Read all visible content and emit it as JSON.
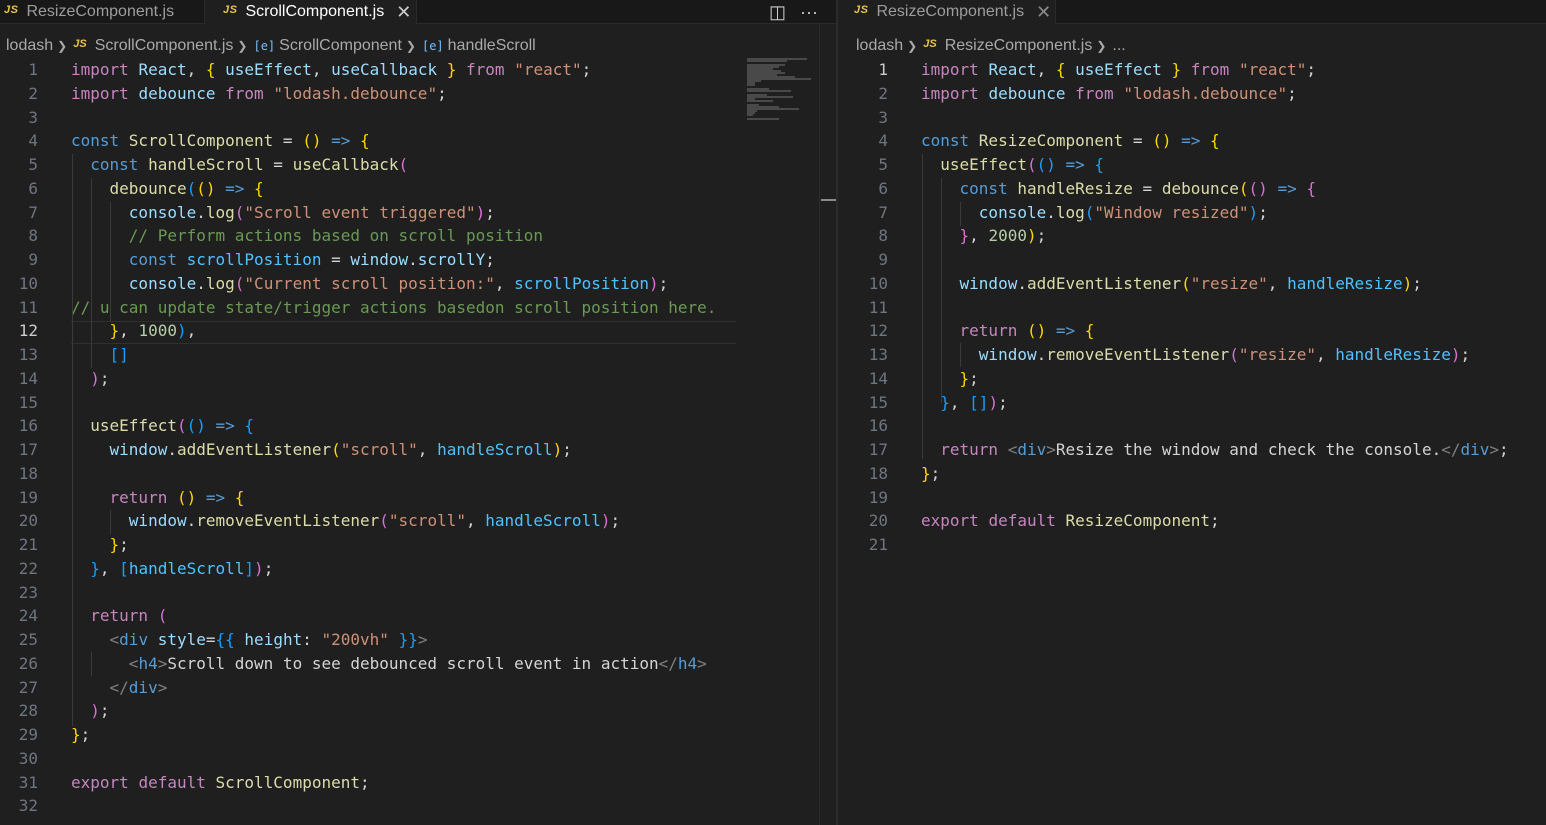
{
  "colors": {
    "keyword": "#569cd6",
    "control": "#c586c0",
    "function": "#dcdcaa",
    "variable": "#9cdcfe",
    "constant": "#4fc1ff",
    "string": "#ce9178",
    "number": "#b5cea8",
    "comment": "#6a9955",
    "punctuation": "#d4d4d4",
    "bracket1": "#ffd700",
    "bracket2": "#da70d6",
    "bracket3": "#179fff",
    "tag": "#808080"
  },
  "left": {
    "tabs": [
      {
        "icon": "js-file-icon",
        "icon_text": "JS",
        "label": "ResizeComponent.js",
        "active": false
      },
      {
        "icon": "js-file-icon",
        "icon_text": "JS",
        "label": "ScrollComponent.js",
        "active": true,
        "close": "✕"
      }
    ],
    "actions": [
      {
        "name": "split-editor-icon",
        "glyph": "◫"
      },
      {
        "name": "more-actions-icon",
        "glyph": "···"
      }
    ],
    "breadcrumb": {
      "folder": "lodash",
      "js_icon": "JS",
      "file": "ScrollComponent.js",
      "symbol_icon": "[e]",
      "symbol": "ScrollComponent",
      "member_icon": "[e]",
      "member": "handleScroll"
    },
    "current_line": 12,
    "lines": [
      [
        [
          "import ",
          "c"
        ],
        [
          "React",
          "v"
        ],
        [
          ", ",
          "p"
        ],
        [
          "{",
          "b1"
        ],
        [
          " ",
          "p"
        ],
        [
          "useEffect",
          "v"
        ],
        [
          ", ",
          "p"
        ],
        [
          "useCallback",
          "v"
        ],
        [
          " ",
          "p"
        ],
        [
          "}",
          "b1"
        ],
        [
          " ",
          "p"
        ],
        [
          "from",
          "c"
        ],
        [
          " ",
          "p"
        ],
        [
          "\"react\"",
          "s"
        ],
        [
          ";",
          "p"
        ]
      ],
      [
        [
          "import ",
          "c"
        ],
        [
          "debounce",
          "v"
        ],
        [
          " ",
          "p"
        ],
        [
          "from",
          "c"
        ],
        [
          " ",
          "p"
        ],
        [
          "\"lodash.debounce\"",
          "s"
        ],
        [
          ";",
          "p"
        ]
      ],
      [],
      [
        [
          "const ",
          "k"
        ],
        [
          "ScrollComponent",
          "f"
        ],
        [
          " = ",
          "p"
        ],
        [
          "()",
          "b1"
        ],
        [
          " ",
          "p"
        ],
        [
          "=>",
          "k"
        ],
        [
          " ",
          "p"
        ],
        [
          "{",
          "b1"
        ]
      ],
      [
        [
          "  const ",
          "k"
        ],
        [
          "handleScroll",
          "f"
        ],
        [
          " = ",
          "p"
        ],
        [
          "useCallback",
          "f"
        ],
        [
          "(",
          "b2"
        ]
      ],
      [
        [
          "    debounce",
          "f"
        ],
        [
          "(",
          "b3"
        ],
        [
          "()",
          "b1"
        ],
        [
          " ",
          "p"
        ],
        [
          "=>",
          "k"
        ],
        [
          " ",
          "p"
        ],
        [
          "{",
          "b1"
        ]
      ],
      [
        [
          "      console",
          "v"
        ],
        [
          ".",
          "p"
        ],
        [
          "log",
          "f"
        ],
        [
          "(",
          "b2"
        ],
        [
          "\"Scroll event triggered\"",
          "s"
        ],
        [
          ")",
          "b2"
        ],
        [
          ";",
          "p"
        ]
      ],
      [
        [
          "      // Perform actions based on scroll position",
          "cm"
        ]
      ],
      [
        [
          "      const ",
          "k"
        ],
        [
          "scrollPosition",
          "t"
        ],
        [
          " = ",
          "p"
        ],
        [
          "window",
          "v"
        ],
        [
          ".",
          "p"
        ],
        [
          "scrollY",
          "v"
        ],
        [
          ";",
          "p"
        ]
      ],
      [
        [
          "      console",
          "v"
        ],
        [
          ".",
          "p"
        ],
        [
          "log",
          "f"
        ],
        [
          "(",
          "b2"
        ],
        [
          "\"Current scroll position:\"",
          "s"
        ],
        [
          ", ",
          "p"
        ],
        [
          "scrollPosition",
          "t"
        ],
        [
          ")",
          "b2"
        ],
        [
          ";",
          "p"
        ]
      ],
      [
        [
          "// u can update state/trigger actions basedon scroll position here.",
          "cm"
        ]
      ],
      [
        [
          "    }",
          "b1"
        ],
        [
          ", ",
          "p"
        ],
        [
          "1000",
          "n"
        ],
        [
          ")",
          "b3"
        ],
        [
          ",",
          "p"
        ]
      ],
      [
        [
          "    []",
          "b3"
        ]
      ],
      [
        [
          "  )",
          "b2"
        ],
        [
          ";",
          "p"
        ]
      ],
      [],
      [
        [
          "  useEffect",
          "f"
        ],
        [
          "(",
          "b2"
        ],
        [
          "()",
          "b3"
        ],
        [
          " ",
          "p"
        ],
        [
          "=>",
          "k"
        ],
        [
          " ",
          "p"
        ],
        [
          "{",
          "b3"
        ]
      ],
      [
        [
          "    window",
          "v"
        ],
        [
          ".",
          "p"
        ],
        [
          "addEventListener",
          "f"
        ],
        [
          "(",
          "b1"
        ],
        [
          "\"scroll\"",
          "s"
        ],
        [
          ", ",
          "p"
        ],
        [
          "handleScroll",
          "t"
        ],
        [
          ")",
          "b1"
        ],
        [
          ";",
          "p"
        ]
      ],
      [],
      [
        [
          "    return ",
          "c"
        ],
        [
          "()",
          "b1"
        ],
        [
          " ",
          "p"
        ],
        [
          "=>",
          "k"
        ],
        [
          " ",
          "p"
        ],
        [
          "{",
          "b1"
        ]
      ],
      [
        [
          "      window",
          "v"
        ],
        [
          ".",
          "p"
        ],
        [
          "removeEventListener",
          "f"
        ],
        [
          "(",
          "b2"
        ],
        [
          "\"scroll\"",
          "s"
        ],
        [
          ", ",
          "p"
        ],
        [
          "handleScroll",
          "t"
        ],
        [
          ")",
          "b2"
        ],
        [
          ";",
          "p"
        ]
      ],
      [
        [
          "    }",
          "b1"
        ],
        [
          ";",
          "p"
        ]
      ],
      [
        [
          "  }",
          "b3"
        ],
        [
          ", ",
          "p"
        ],
        [
          "[",
          "b3"
        ],
        [
          "handleScroll",
          "t"
        ],
        [
          "]",
          "b3"
        ],
        [
          ")",
          "b2"
        ],
        [
          ";",
          "p"
        ]
      ],
      [],
      [
        [
          "  return ",
          "c"
        ],
        [
          "(",
          "b2"
        ]
      ],
      [
        [
          "    <",
          "g"
        ],
        [
          "div ",
          "k"
        ],
        [
          "style",
          "v"
        ],
        [
          "=",
          "p"
        ],
        [
          "{{",
          "b3"
        ],
        [
          " ",
          "p"
        ],
        [
          "height",
          "v"
        ],
        [
          ": ",
          "p"
        ],
        [
          "\"200vh\"",
          "s"
        ],
        [
          " ",
          "p"
        ],
        [
          "}}",
          "b3"
        ],
        [
          ">",
          "g"
        ]
      ],
      [
        [
          "      <",
          "g"
        ],
        [
          "h4",
          "k"
        ],
        [
          ">",
          "g"
        ],
        [
          "Scroll down to see debounced scroll event in action",
          "p"
        ],
        [
          "</",
          "g"
        ],
        [
          "h4",
          "k"
        ],
        [
          ">",
          "g"
        ]
      ],
      [
        [
          "    </",
          "g"
        ],
        [
          "div",
          "k"
        ],
        [
          ">",
          "g"
        ]
      ],
      [
        [
          "  )",
          "b2"
        ],
        [
          ";",
          "p"
        ]
      ],
      [
        [
          "}",
          "b1"
        ],
        [
          ";",
          "p"
        ]
      ],
      [],
      [
        [
          "export ",
          "c"
        ],
        [
          "default ",
          "c"
        ],
        [
          "ScrollComponent",
          "f"
        ],
        [
          ";",
          "p"
        ]
      ],
      []
    ]
  },
  "right": {
    "tabs": [
      {
        "icon": "js-file-icon",
        "icon_text": "JS",
        "label": "ResizeComponent.js",
        "active": true,
        "close": "✕"
      }
    ],
    "breadcrumb": {
      "folder": "lodash",
      "js_icon": "JS",
      "file": "ResizeComponent.js",
      "ellipsis": "..."
    },
    "current_line": 1,
    "lines": [
      [
        [
          "import ",
          "c"
        ],
        [
          "React",
          "v"
        ],
        [
          ", ",
          "p"
        ],
        [
          "{",
          "b1"
        ],
        [
          " ",
          "p"
        ],
        [
          "useEffect",
          "v"
        ],
        [
          " ",
          "p"
        ],
        [
          "}",
          "b1"
        ],
        [
          " ",
          "p"
        ],
        [
          "from",
          "c"
        ],
        [
          " ",
          "p"
        ],
        [
          "\"react\"",
          "s"
        ],
        [
          ";",
          "p"
        ]
      ],
      [
        [
          "import ",
          "c"
        ],
        [
          "debounce",
          "v"
        ],
        [
          " ",
          "p"
        ],
        [
          "from",
          "c"
        ],
        [
          " ",
          "p"
        ],
        [
          "\"lodash.debounce\"",
          "s"
        ],
        [
          ";",
          "p"
        ]
      ],
      [],
      [
        [
          "const ",
          "k"
        ],
        [
          "ResizeComponent",
          "f"
        ],
        [
          " = ",
          "p"
        ],
        [
          "()",
          "b1"
        ],
        [
          " ",
          "p"
        ],
        [
          "=>",
          "k"
        ],
        [
          " ",
          "p"
        ],
        [
          "{",
          "b1"
        ]
      ],
      [
        [
          "  useEffect",
          "f"
        ],
        [
          "(",
          "b2"
        ],
        [
          "()",
          "b3"
        ],
        [
          " ",
          "p"
        ],
        [
          "=>",
          "k"
        ],
        [
          " ",
          "p"
        ],
        [
          "{",
          "b3"
        ]
      ],
      [
        [
          "    const ",
          "k"
        ],
        [
          "handleResize",
          "f"
        ],
        [
          " = ",
          "p"
        ],
        [
          "debounce",
          "f"
        ],
        [
          "(",
          "b1"
        ],
        [
          "()",
          "b2"
        ],
        [
          " ",
          "p"
        ],
        [
          "=>",
          "k"
        ],
        [
          " ",
          "p"
        ],
        [
          "{",
          "b2"
        ]
      ],
      [
        [
          "      console",
          "v"
        ],
        [
          ".",
          "p"
        ],
        [
          "log",
          "f"
        ],
        [
          "(",
          "b3"
        ],
        [
          "\"Window resized\"",
          "s"
        ],
        [
          ")",
          "b3"
        ],
        [
          ";",
          "p"
        ]
      ],
      [
        [
          "    }",
          "b2"
        ],
        [
          ", ",
          "p"
        ],
        [
          "2000",
          "n"
        ],
        [
          ")",
          "b1"
        ],
        [
          ";",
          "p"
        ]
      ],
      [],
      [
        [
          "    window",
          "v"
        ],
        [
          ".",
          "p"
        ],
        [
          "addEventListener",
          "f"
        ],
        [
          "(",
          "b1"
        ],
        [
          "\"resize\"",
          "s"
        ],
        [
          ", ",
          "p"
        ],
        [
          "handleResize",
          "t"
        ],
        [
          ")",
          "b1"
        ],
        [
          ";",
          "p"
        ]
      ],
      [],
      [
        [
          "    return ",
          "c"
        ],
        [
          "()",
          "b1"
        ],
        [
          " ",
          "p"
        ],
        [
          "=>",
          "k"
        ],
        [
          " ",
          "p"
        ],
        [
          "{",
          "b1"
        ]
      ],
      [
        [
          "      window",
          "v"
        ],
        [
          ".",
          "p"
        ],
        [
          "removeEventListener",
          "f"
        ],
        [
          "(",
          "b2"
        ],
        [
          "\"resize\"",
          "s"
        ],
        [
          ", ",
          "p"
        ],
        [
          "handleResize",
          "t"
        ],
        [
          ")",
          "b2"
        ],
        [
          ";",
          "p"
        ]
      ],
      [
        [
          "    }",
          "b1"
        ],
        [
          ";",
          "p"
        ]
      ],
      [
        [
          "  }",
          "b3"
        ],
        [
          ", ",
          "p"
        ],
        [
          "[]",
          "b3"
        ],
        [
          ")",
          "b2"
        ],
        [
          ";",
          "p"
        ]
      ],
      [],
      [
        [
          "  return ",
          "c"
        ],
        [
          "<",
          "g"
        ],
        [
          "div",
          "k"
        ],
        [
          ">",
          "g"
        ],
        [
          "Resize the window and check the console.",
          "p"
        ],
        [
          "</",
          "g"
        ],
        [
          "div",
          "k"
        ],
        [
          ">",
          "g"
        ],
        [
          ";",
          "p"
        ]
      ],
      [
        [
          "}",
          "b1"
        ],
        [
          ";",
          "p"
        ]
      ],
      [],
      [
        [
          "export ",
          "c"
        ],
        [
          "default ",
          "c"
        ],
        [
          "ResizeComponent",
          "f"
        ],
        [
          ";",
          "p"
        ]
      ],
      []
    ]
  }
}
